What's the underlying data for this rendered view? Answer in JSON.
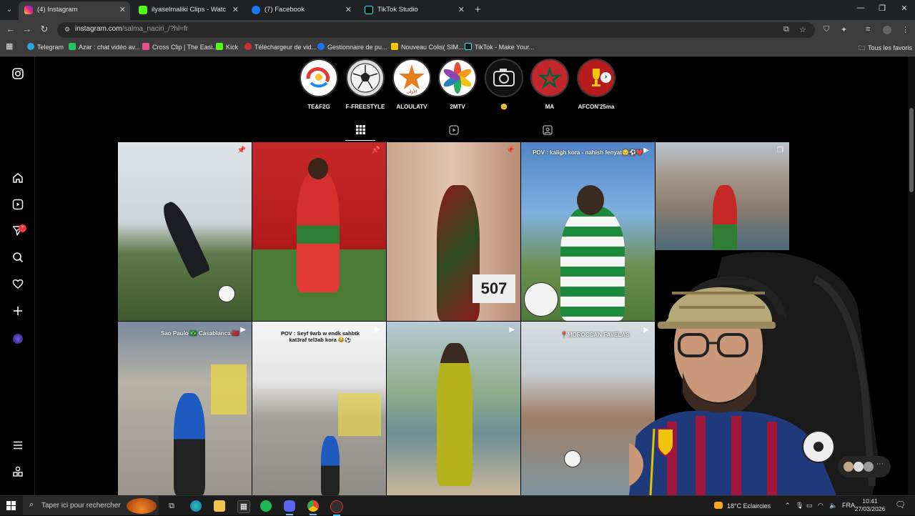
{
  "tabs": [
    {
      "title": "(4) Instagram",
      "favicon_color": "#e1306c"
    },
    {
      "title": "ilyaselmaliki Clips - Watch Live",
      "favicon_color": "#53fc18"
    },
    {
      "title": "(7) Facebook",
      "favicon_color": "#1877f2"
    },
    {
      "title": "TikTok Studio",
      "favicon_color": "#111111"
    }
  ],
  "address": {
    "domain": "instagram.com",
    "path": "/salma_naciri_/?hl=fr"
  },
  "bookmarks": [
    {
      "label": "Telegram",
      "color": "#2aa3e0"
    },
    {
      "label": "Azar : chat vidéo av...",
      "color": "#22c55e"
    },
    {
      "label": "Cross Clip | The Easi...",
      "color": "#e94e8f"
    },
    {
      "label": "Kick",
      "color": "#53fc18"
    },
    {
      "label": "Téléchargeur de vid...",
      "color": "#d32f2f"
    },
    {
      "label": "Gestionnaire de pu...",
      "color": "#1877f2"
    },
    {
      "label": "Nouveau Colis( SIM...",
      "color": "#f5c400"
    },
    {
      "label": "TikTok - Make Your...",
      "color": "#111111"
    }
  ],
  "all_bookmarks": "Tous les favoris",
  "sidebar": {
    "icons": [
      "instagram-logo-icon",
      "home-icon",
      "reels-icon",
      "messages-icon",
      "search-icon",
      "notifications-icon",
      "create-icon",
      "profile-avatar",
      "menu-icon",
      "more-icon"
    ],
    "messages_badge": "7"
  },
  "highlights": [
    {
      "label": "TE&F2G"
    },
    {
      "label": "F-FREESTYLE"
    },
    {
      "label": "ALOULATV"
    },
    {
      "label": "2MTV"
    },
    {
      "label": "😑"
    },
    {
      "label": "MA"
    },
    {
      "label": "AFCON'25ma"
    }
  ],
  "profile_tabs": [
    "posts-grid-icon",
    "reels-tab-icon",
    "tagged-tab-icon"
  ],
  "posts": [
    {
      "type": "pinned",
      "caption": ""
    },
    {
      "type": "pinned",
      "caption": ""
    },
    {
      "type": "pinned",
      "caption": ""
    },
    {
      "type": "reel",
      "caption": "POV : kaligh kora - nahish fenyat😔⚽❤️"
    },
    {
      "type": "carousel",
      "caption": ""
    },
    {
      "type": "reel",
      "caption": "Sao Paulo 🇧🇷 Casablanca 🇲🇦"
    },
    {
      "type": "reel",
      "caption": "POV : Seyf 9arb w endk sahbtk kat3raf tel3ab kora 😂⚽"
    },
    {
      "type": "reel",
      "caption": ""
    },
    {
      "type": "reel",
      "caption": "📍MOROCCAN FAVELAS"
    }
  ],
  "taskbar": {
    "search_placeholder": "Taper ici pour rechercher",
    "weather": "18°C  Eclaircies",
    "lang": "FRA",
    "time": "10:41",
    "date": "27/03/2026"
  }
}
